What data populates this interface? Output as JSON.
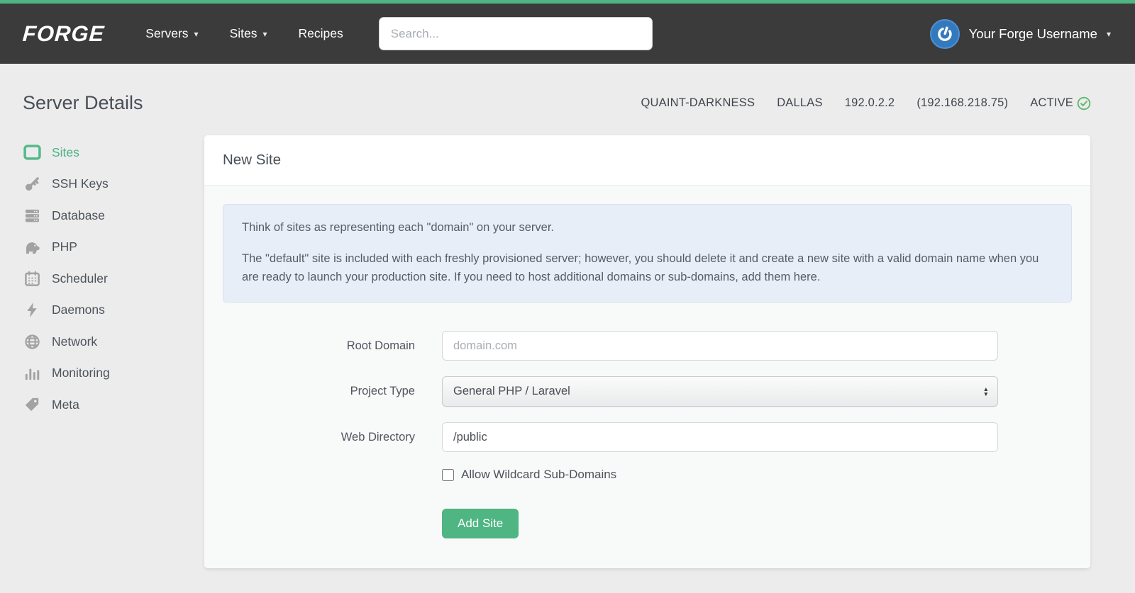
{
  "navbar": {
    "logo": "FORGE",
    "items": [
      {
        "label": "Servers"
      },
      {
        "label": "Sites"
      },
      {
        "label": "Recipes"
      }
    ],
    "search_placeholder": "Search...",
    "user": {
      "name": "Your Forge Username"
    }
  },
  "page": {
    "title": "Server Details",
    "server_meta": {
      "name": "QUAINT-DARKNESS",
      "region": "DALLAS",
      "ip": "192.0.2.2",
      "private_ip": "(192.168.218.75)",
      "status": "ACTIVE"
    }
  },
  "sidebar": {
    "items": [
      {
        "label": "Sites",
        "icon": "window-icon",
        "active": true
      },
      {
        "label": "SSH Keys",
        "icon": "key-icon",
        "active": false
      },
      {
        "label": "Database",
        "icon": "database-icon",
        "active": false
      },
      {
        "label": "PHP",
        "icon": "elephant-icon",
        "active": false
      },
      {
        "label": "Scheduler",
        "icon": "calendar-icon",
        "active": false
      },
      {
        "label": "Daemons",
        "icon": "bolt-icon",
        "active": false
      },
      {
        "label": "Network",
        "icon": "globe-icon",
        "active": false
      },
      {
        "label": "Monitoring",
        "icon": "bar-chart-icon",
        "active": false
      },
      {
        "label": "Meta",
        "icon": "tag-icon",
        "active": false
      }
    ]
  },
  "card": {
    "title": "New Site",
    "info": {
      "p1": "Think of sites as representing each \"domain\" on your server.",
      "p2": "The \"default\" site is included with each freshly provisioned server; however, you should delete it and create a new site with a valid domain name when you are ready to launch your production site. If you need to host additional domains or sub-domains, add them here."
    },
    "form": {
      "root_domain": {
        "label": "Root Domain",
        "placeholder": "domain.com",
        "value": ""
      },
      "project_type": {
        "label": "Project Type",
        "selected": "General PHP / Laravel"
      },
      "web_directory": {
        "label": "Web Directory",
        "value": "/public"
      },
      "wildcard": {
        "label": "Allow Wildcard Sub-Domains",
        "checked": false
      },
      "submit_label": "Add Site"
    }
  },
  "colors": {
    "accent_green": "#4fb583",
    "navbar_bg": "#3b3b3b",
    "status_green": "#5cb86c",
    "avatar_blue": "#3379bd"
  }
}
